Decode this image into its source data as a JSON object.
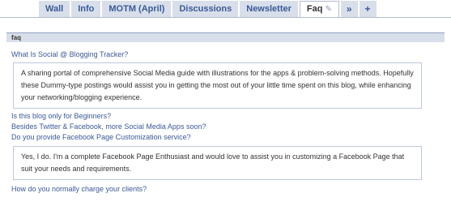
{
  "tabs": [
    {
      "label": "Wall"
    },
    {
      "label": "Info"
    },
    {
      "label": "MOTM (April)"
    },
    {
      "label": "Discussions"
    },
    {
      "label": "Newsletter"
    },
    {
      "label": "Faq",
      "active": true
    }
  ],
  "tab_more_glyph": "»",
  "tab_add_glyph": "+",
  "section_title": "faq",
  "faq": [
    {
      "question": "What Is Social @ Blogging Tracker?",
      "answer": "A sharing portal of comprehensive Social Media guide with illustrations for the apps & problem-solving methods. Hopefully these Dummy-type postings would assist you in getting the most out of your little time spent on this blog, while enhancing your networking/blogging experience."
    },
    {
      "question": "Is this blog only for Beginners?"
    },
    {
      "question": "Besides Twitter & Facebook, more Social Media Apps soon?"
    },
    {
      "question": "Do you provide Facebook Page Customization service?",
      "answer": "Yes, I do. I'm a complete Facebook Page Enthusiast and would love to assist you in customizing a Facebook Page that suit your needs and requirements."
    },
    {
      "question": "How do you normally charge your clients?"
    }
  ],
  "colors": {
    "link": "#3b5998",
    "tab_bg": "#d8dfea",
    "border": "#bdc7d8"
  },
  "icons": {
    "edit": "pencil-icon",
    "more": "more-tabs-icon",
    "add": "add-tab-icon"
  }
}
